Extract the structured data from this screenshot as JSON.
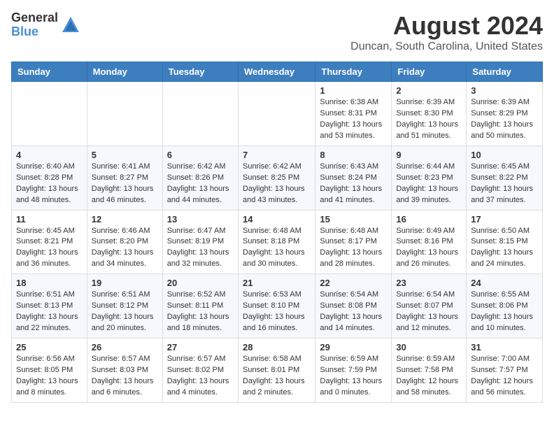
{
  "logo": {
    "general": "General",
    "blue": "Blue"
  },
  "title": {
    "month_year": "August 2024",
    "location": "Duncan, South Carolina, United States"
  },
  "weekdays": [
    "Sunday",
    "Monday",
    "Tuesday",
    "Wednesday",
    "Thursday",
    "Friday",
    "Saturday"
  ],
  "weeks": [
    [
      {
        "day": "",
        "info": ""
      },
      {
        "day": "",
        "info": ""
      },
      {
        "day": "",
        "info": ""
      },
      {
        "day": "",
        "info": ""
      },
      {
        "day": "1",
        "info": "Sunrise: 6:38 AM\nSunset: 8:31 PM\nDaylight: 13 hours\nand 53 minutes."
      },
      {
        "day": "2",
        "info": "Sunrise: 6:39 AM\nSunset: 8:30 PM\nDaylight: 13 hours\nand 51 minutes."
      },
      {
        "day": "3",
        "info": "Sunrise: 6:39 AM\nSunset: 8:29 PM\nDaylight: 13 hours\nand 50 minutes."
      }
    ],
    [
      {
        "day": "4",
        "info": "Sunrise: 6:40 AM\nSunset: 8:28 PM\nDaylight: 13 hours\nand 48 minutes."
      },
      {
        "day": "5",
        "info": "Sunrise: 6:41 AM\nSunset: 8:27 PM\nDaylight: 13 hours\nand 46 minutes."
      },
      {
        "day": "6",
        "info": "Sunrise: 6:42 AM\nSunset: 8:26 PM\nDaylight: 13 hours\nand 44 minutes."
      },
      {
        "day": "7",
        "info": "Sunrise: 6:42 AM\nSunset: 8:25 PM\nDaylight: 13 hours\nand 43 minutes."
      },
      {
        "day": "8",
        "info": "Sunrise: 6:43 AM\nSunset: 8:24 PM\nDaylight: 13 hours\nand 41 minutes."
      },
      {
        "day": "9",
        "info": "Sunrise: 6:44 AM\nSunset: 8:23 PM\nDaylight: 13 hours\nand 39 minutes."
      },
      {
        "day": "10",
        "info": "Sunrise: 6:45 AM\nSunset: 8:22 PM\nDaylight: 13 hours\nand 37 minutes."
      }
    ],
    [
      {
        "day": "11",
        "info": "Sunrise: 6:45 AM\nSunset: 8:21 PM\nDaylight: 13 hours\nand 36 minutes."
      },
      {
        "day": "12",
        "info": "Sunrise: 6:46 AM\nSunset: 8:20 PM\nDaylight: 13 hours\nand 34 minutes."
      },
      {
        "day": "13",
        "info": "Sunrise: 6:47 AM\nSunset: 8:19 PM\nDaylight: 13 hours\nand 32 minutes."
      },
      {
        "day": "14",
        "info": "Sunrise: 6:48 AM\nSunset: 8:18 PM\nDaylight: 13 hours\nand 30 minutes."
      },
      {
        "day": "15",
        "info": "Sunrise: 6:48 AM\nSunset: 8:17 PM\nDaylight: 13 hours\nand 28 minutes."
      },
      {
        "day": "16",
        "info": "Sunrise: 6:49 AM\nSunset: 8:16 PM\nDaylight: 13 hours\nand 26 minutes."
      },
      {
        "day": "17",
        "info": "Sunrise: 6:50 AM\nSunset: 8:15 PM\nDaylight: 13 hours\nand 24 minutes."
      }
    ],
    [
      {
        "day": "18",
        "info": "Sunrise: 6:51 AM\nSunset: 8:13 PM\nDaylight: 13 hours\nand 22 minutes."
      },
      {
        "day": "19",
        "info": "Sunrise: 6:51 AM\nSunset: 8:12 PM\nDaylight: 13 hours\nand 20 minutes."
      },
      {
        "day": "20",
        "info": "Sunrise: 6:52 AM\nSunset: 8:11 PM\nDaylight: 13 hours\nand 18 minutes."
      },
      {
        "day": "21",
        "info": "Sunrise: 6:53 AM\nSunset: 8:10 PM\nDaylight: 13 hours\nand 16 minutes."
      },
      {
        "day": "22",
        "info": "Sunrise: 6:54 AM\nSunset: 8:08 PM\nDaylight: 13 hours\nand 14 minutes."
      },
      {
        "day": "23",
        "info": "Sunrise: 6:54 AM\nSunset: 8:07 PM\nDaylight: 13 hours\nand 12 minutes."
      },
      {
        "day": "24",
        "info": "Sunrise: 6:55 AM\nSunset: 8:06 PM\nDaylight: 13 hours\nand 10 minutes."
      }
    ],
    [
      {
        "day": "25",
        "info": "Sunrise: 6:56 AM\nSunset: 8:05 PM\nDaylight: 13 hours\nand 8 minutes."
      },
      {
        "day": "26",
        "info": "Sunrise: 6:57 AM\nSunset: 8:03 PM\nDaylight: 13 hours\nand 6 minutes."
      },
      {
        "day": "27",
        "info": "Sunrise: 6:57 AM\nSunset: 8:02 PM\nDaylight: 13 hours\nand 4 minutes."
      },
      {
        "day": "28",
        "info": "Sunrise: 6:58 AM\nSunset: 8:01 PM\nDaylight: 13 hours\nand 2 minutes."
      },
      {
        "day": "29",
        "info": "Sunrise: 6:59 AM\nSunset: 7:59 PM\nDaylight: 13 hours\nand 0 minutes."
      },
      {
        "day": "30",
        "info": "Sunrise: 6:59 AM\nSunset: 7:58 PM\nDaylight: 12 hours\nand 58 minutes."
      },
      {
        "day": "31",
        "info": "Sunrise: 7:00 AM\nSunset: 7:57 PM\nDaylight: 12 hours\nand 56 minutes."
      }
    ]
  ]
}
